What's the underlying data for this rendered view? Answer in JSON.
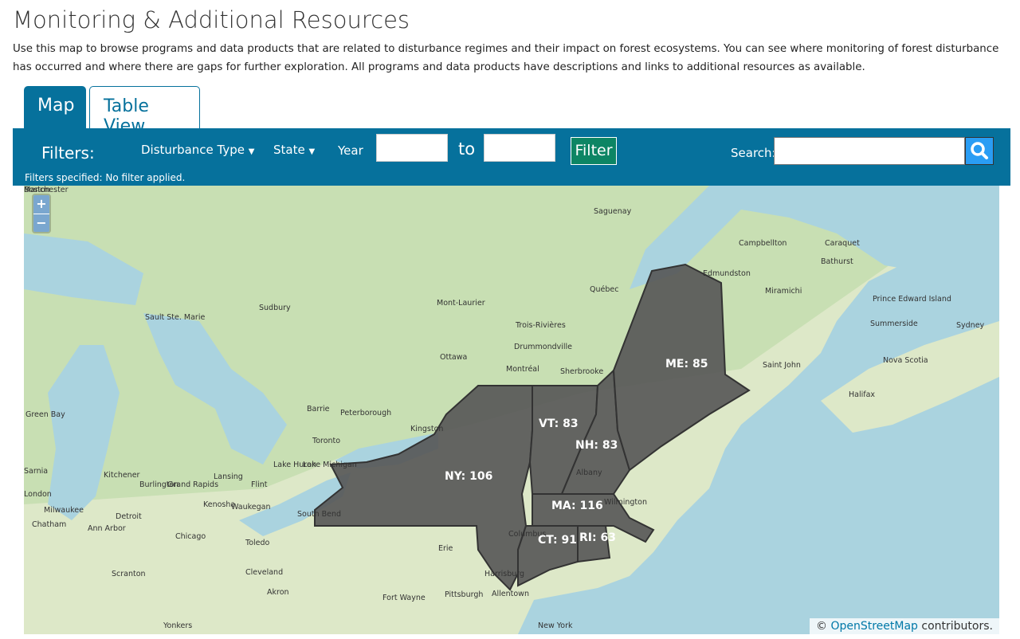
{
  "page": {
    "title": "Monitoring & Additional Resources",
    "description": "Use this map to browse programs and data products that are related to disturbance regimes and their impact on forest ecosystems. You can see where monitoring of forest disturbance has occurred and where there are gaps for further exploration. All programs and data products have descriptions and links to additional resources as available."
  },
  "tabs": [
    {
      "label": "Map",
      "active": true
    },
    {
      "label": "Table View",
      "active": false
    }
  ],
  "filters": {
    "label": "Filters:",
    "disturbance_type": "Disturbance Type",
    "state": "State",
    "year": "Year",
    "year_from": "",
    "to": "to",
    "year_to": "",
    "filter_button": "Filter",
    "search_label": "Search:",
    "search_value": "",
    "status": "Filters specified: No filter applied."
  },
  "map": {
    "zoom_in": "+",
    "zoom_out": "−",
    "attribution_prefix": "©",
    "attribution_link": "OpenStreetMap",
    "attribution_suffix": " contributors.",
    "states": [
      {
        "label": "ME: 85"
      },
      {
        "label": "VT: 83"
      },
      {
        "label": "NH: 83"
      },
      {
        "label": "NY: 106"
      },
      {
        "label": "MA: 116"
      },
      {
        "label": "CT: 91"
      },
      {
        "label": "RI: 63"
      }
    ],
    "state_fill": "#555555",
    "cities": [
      "Saguenay",
      "Campbellton",
      "Caraquet",
      "Bathurst",
      "Edmundston",
      "Miramichi",
      "Québec",
      "Prince Edward Island",
      "Summerside",
      "Sydney",
      "Sudbury",
      "Mont-Laurier",
      "Trois-Rivières",
      "Drummondville",
      "Sault Ste. Marie",
      "Ottawa",
      "Montréal",
      "Sherbrooke",
      "Saint John",
      "Nova Scotia",
      "Halifax",
      "Barrie",
      "Peterborough",
      "Kingston",
      "Green Bay",
      "Toronto",
      "Lake Huron",
      "Lake Michigan",
      "Kitchener",
      "Burlington",
      "Grand Rapids",
      "Lansing",
      "Flint",
      "Sarnia",
      "London",
      "Milwaukee",
      "Kenosha",
      "Waukegan",
      "Detroit",
      "Chatham",
      "Ann Arbor",
      "Chicago",
      "South Bend",
      "Toledo",
      "Erie",
      "Cleveland",
      "Scranton",
      "Akron",
      "Fort Wayne",
      "Pittsburgh",
      "Harrisburg",
      "Allentown",
      "Yonkers",
      "New York",
      "Columbus",
      "Wilmington",
      "Albany",
      "Boston",
      "Manchester"
    ]
  }
}
